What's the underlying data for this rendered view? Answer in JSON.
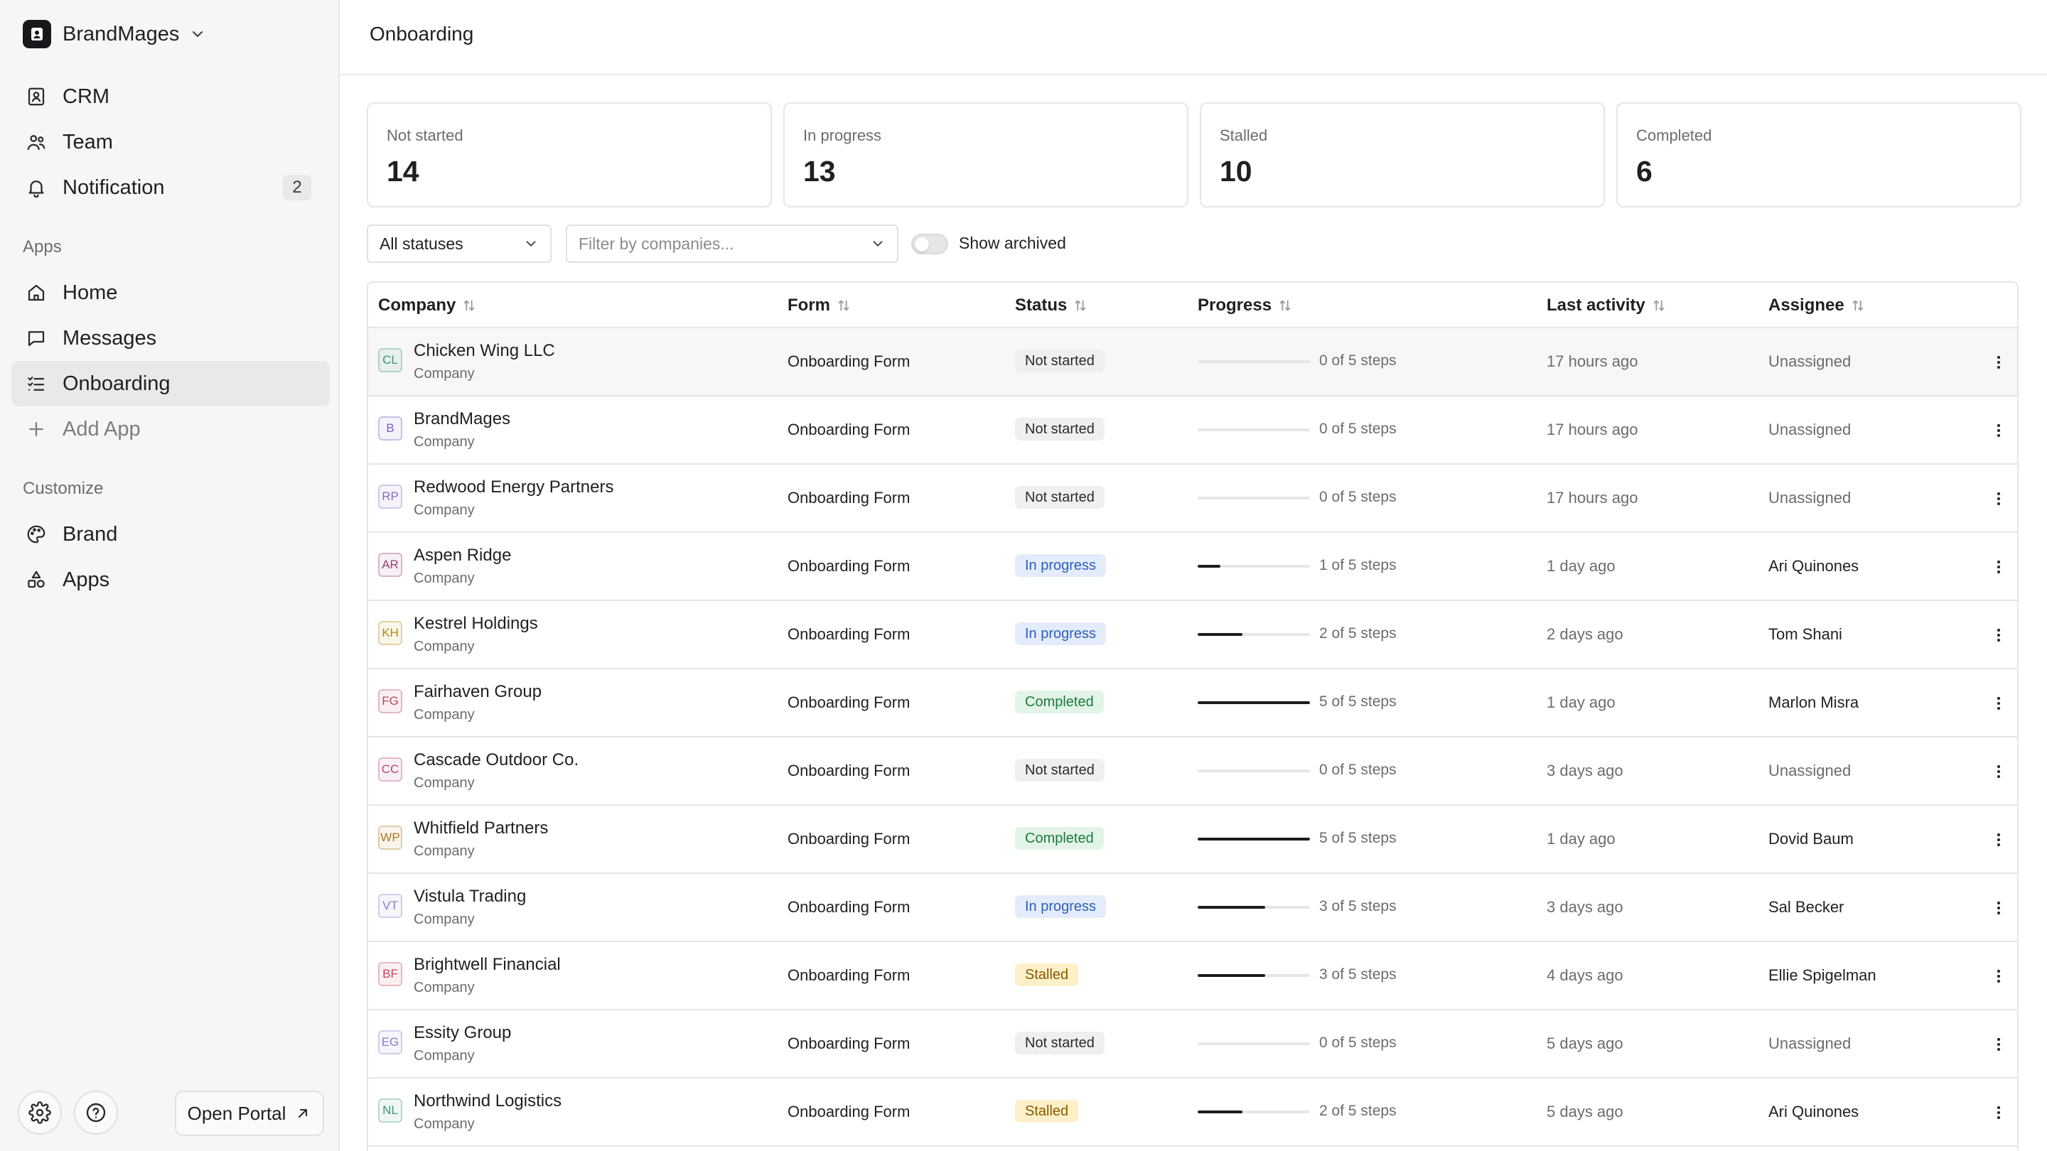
{
  "workspace": {
    "name": "BrandMages"
  },
  "sidebar": {
    "top_items": [
      {
        "label": "CRM",
        "icon": "contact-book-icon"
      },
      {
        "label": "Team",
        "icon": "team-icon"
      },
      {
        "label": "Notification",
        "icon": "bell-icon",
        "badge": "2"
      }
    ],
    "apps_section_label": "Apps",
    "apps_items": [
      {
        "label": "Home",
        "icon": "home-icon"
      },
      {
        "label": "Messages",
        "icon": "message-icon"
      },
      {
        "label": "Onboarding",
        "icon": "checklist-icon",
        "active": true
      },
      {
        "label": "Add App",
        "icon": "plus-icon"
      }
    ],
    "customize_section_label": "Customize",
    "customize_items": [
      {
        "label": "Brand",
        "icon": "palette-icon"
      },
      {
        "label": "Apps",
        "icon": "shapes-icon"
      }
    ],
    "footer": {
      "open_portal_label": "Open Portal"
    }
  },
  "page": {
    "title": "Onboarding"
  },
  "summary_cards": [
    {
      "label": "Not started",
      "value": "14"
    },
    {
      "label": "In progress",
      "value": "13"
    },
    {
      "label": "Stalled",
      "value": "10"
    },
    {
      "label": "Completed",
      "value": "6"
    }
  ],
  "filters": {
    "status_select": "All statuses",
    "company_placeholder": "Filter by companies...",
    "show_archived_label": "Show archived",
    "show_archived_on": false
  },
  "table": {
    "columns": [
      "Company",
      "Form",
      "Status",
      "Progress",
      "Last activity",
      "Assignee"
    ],
    "status_colors": {
      "Not started": {
        "bg": "#efeff1",
        "fg": "#2a2b2f"
      },
      "In progress": {
        "bg": "#e4ecfb",
        "fg": "#2f5fb8"
      },
      "Completed": {
        "bg": "#e2f4e7",
        "fg": "#1f7a3d"
      },
      "Stalled": {
        "bg": "#fdf0c9",
        "fg": "#8a5a00"
      }
    },
    "rows": [
      {
        "initials": "CL",
        "avatar_color": "#3f9a70",
        "company": "Chicken Wing LLC",
        "type": "Company",
        "form": "Onboarding Form",
        "status": "Not started",
        "progress": 0,
        "steps": "0 of 5 steps",
        "last_activity": "17 hours ago",
        "assignee": "Unassigned"
      },
      {
        "initials": "B",
        "avatar_color": "#7c5cc4",
        "company": "BrandMages",
        "type": "Company",
        "form": "Onboarding Form",
        "status": "Not started",
        "progress": 0,
        "steps": "0 of 5 steps",
        "last_activity": "17 hours ago",
        "assignee": "Unassigned"
      },
      {
        "initials": "RP",
        "avatar_color": "#8a6cc4",
        "company": "Redwood Energy Partners",
        "type": "Company",
        "form": "Onboarding Form",
        "status": "Not started",
        "progress": 0,
        "steps": "0 of 5 steps",
        "last_activity": "17 hours ago",
        "assignee": "Unassigned"
      },
      {
        "initials": "AR",
        "avatar_color": "#9b3d7a",
        "company": "Aspen Ridge",
        "type": "Company",
        "form": "Onboarding Form",
        "status": "In progress",
        "progress": 0.2,
        "steps": "1 of 5 steps",
        "last_activity": "1 day ago",
        "assignee": "Ari Quinones"
      },
      {
        "initials": "KH",
        "avatar_color": "#b8860b",
        "company": "Kestrel Holdings",
        "type": "Company",
        "form": "Onboarding Form",
        "status": "In progress",
        "progress": 0.4,
        "steps": "2 of 5 steps",
        "last_activity": "2 days ago",
        "assignee": "Tom Shani"
      },
      {
        "initials": "FG",
        "avatar_color": "#c0455d",
        "company": "Fairhaven Group",
        "type": "Company",
        "form": "Onboarding Form",
        "status": "Completed",
        "progress": 1,
        "steps": "5 of 5 steps",
        "last_activity": "1 day ago",
        "assignee": "Marlon Misra"
      },
      {
        "initials": "CC",
        "avatar_color": "#b5487a",
        "company": "Cascade Outdoor Co.",
        "type": "Company",
        "form": "Onboarding Form",
        "status": "Not started",
        "progress": 0,
        "steps": "0 of 5 steps",
        "last_activity": "3 days ago",
        "assignee": "Unassigned"
      },
      {
        "initials": "WP",
        "avatar_color": "#b07a1a",
        "company": "Whitfield Partners",
        "type": "Company",
        "form": "Onboarding Form",
        "status": "Completed",
        "progress": 1,
        "steps": "5 of 5 steps",
        "last_activity": "1 day ago",
        "assignee": "Dovid Baum"
      },
      {
        "initials": "VT",
        "avatar_color": "#8a7bd0",
        "company": "Vistula Trading",
        "type": "Company",
        "form": "Onboarding Form",
        "status": "In progress",
        "progress": 0.6,
        "steps": "3 of 5 steps",
        "last_activity": "3 days ago",
        "assignee": "Sal Becker"
      },
      {
        "initials": "BF",
        "avatar_color": "#c0455d",
        "company": "Brightwell Financial",
        "type": "Company",
        "form": "Onboarding Form",
        "status": "Stalled",
        "progress": 0.6,
        "steps": "3 of 5 steps",
        "last_activity": "4 days ago",
        "assignee": "Ellie Spigelman"
      },
      {
        "initials": "EG",
        "avatar_color": "#8a7bd0",
        "company": "Essity Group",
        "type": "Company",
        "form": "Onboarding Form",
        "status": "Not started",
        "progress": 0,
        "steps": "0 of 5 steps",
        "last_activity": "5 days ago",
        "assignee": "Unassigned"
      },
      {
        "initials": "NL",
        "avatar_color": "#3f9a70",
        "company": "Northwind Logistics",
        "type": "Company",
        "form": "Onboarding Form",
        "status": "Stalled",
        "progress": 0.4,
        "steps": "2 of 5 steps",
        "last_activity": "5 days ago",
        "assignee": "Ari Quinones"
      }
    ]
  }
}
